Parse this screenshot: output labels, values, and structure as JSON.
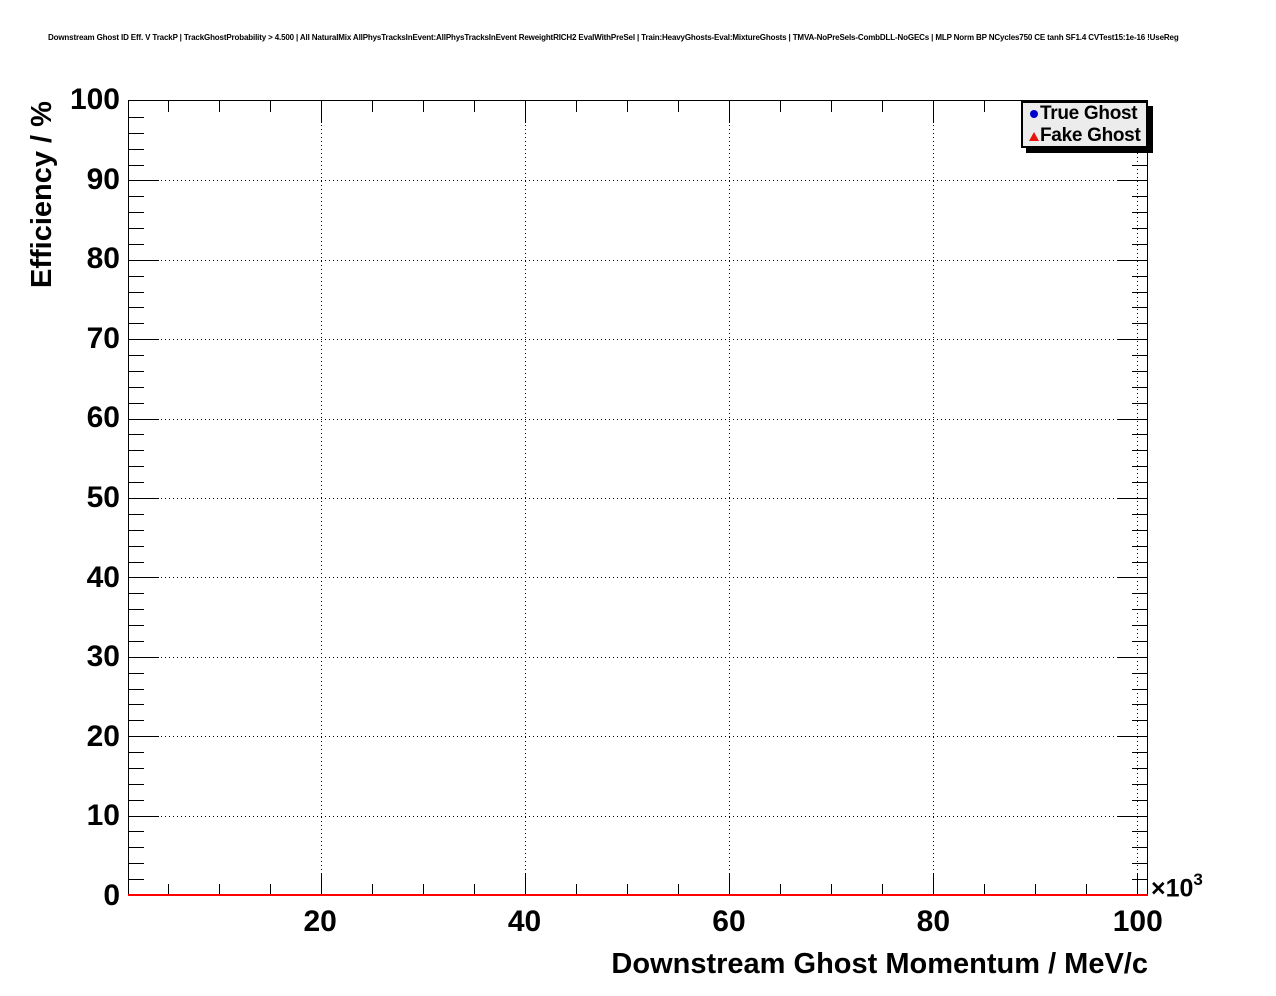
{
  "chart_data": {
    "type": "scatter",
    "title": "Downstream Ghost ID Eff. V TrackP | TrackGhostProbability > 4.500 | All NaturalMix AllPhysTracksInEvent:AllPhysTracksInEvent ReweightRICH2 EvalWithPreSel | Train:HeavyGhosts-Eval:MixtureGhosts | TMVA-NoPreSels-CombDLL-NoGECs | MLP Norm BP NCycles750 CE tanh SF1.4 CVTest15:1e-16 !UseReg",
    "xlabel": "Downstream Ghost Momentum / MeV/c",
    "ylabel": "Efficiency / %",
    "x_exponent": {
      "base": "×10",
      "exp": "3"
    },
    "xlim": [
      1.2,
      101
    ],
    "ylim": [
      0,
      100
    ],
    "x_major_ticks": [
      20,
      40,
      60,
      80,
      100
    ],
    "x_minor_step": 5,
    "y_major_ticks": [
      0,
      10,
      20,
      30,
      40,
      50,
      60,
      70,
      80,
      90,
      100
    ],
    "y_minor_step": 2,
    "grid": "dotted lines at every major tick, both axes",
    "legend": {
      "position": "top-right",
      "entries": [
        {
          "label": "True Ghost",
          "marker": "circle",
          "color": "#0000cc"
        },
        {
          "label": "Fake Ghost",
          "marker": "triangle",
          "color": "#e8130a"
        }
      ]
    },
    "series": [
      {
        "name": "True Ghost",
        "marker": "circle",
        "color": "#0000cc",
        "values": []
      },
      {
        "name": "Fake Ghost",
        "marker": "triangle",
        "color": "#ff0000",
        "y_constant": 0,
        "x_start": 1.2,
        "x_end": 101
      }
    ]
  }
}
